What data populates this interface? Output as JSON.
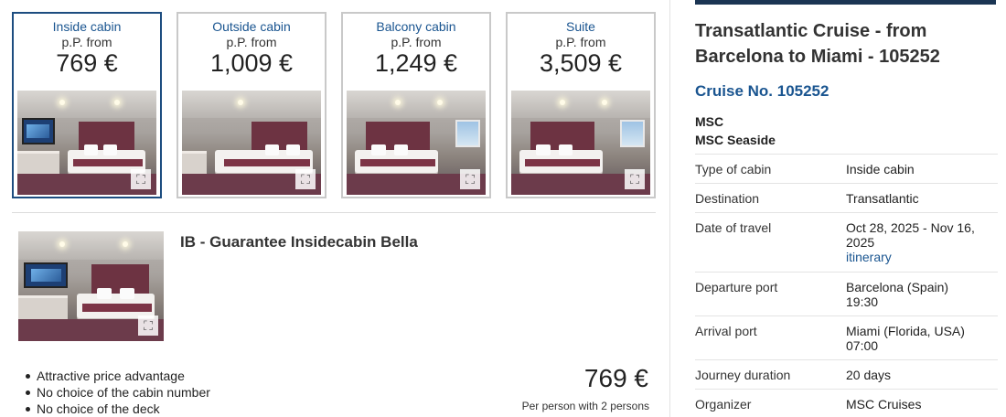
{
  "cabins": [
    {
      "name": "Inside cabin",
      "from_label": "p.P. from",
      "price": "769 €",
      "selected": true
    },
    {
      "name": "Outside cabin",
      "from_label": "p.P. from",
      "price": "1,009 €",
      "selected": false
    },
    {
      "name": "Balcony cabin",
      "from_label": "p.P. from",
      "price": "1,249 €",
      "selected": false
    },
    {
      "name": "Suite",
      "from_label": "p.P. from",
      "price": "3,509 €",
      "selected": false
    }
  ],
  "detail": {
    "title": "IB - Guarantee Insidecabin Bella",
    "features": [
      "Attractive price advantage",
      "No choice of the cabin number",
      "No choice of the deck"
    ],
    "price": "769 €",
    "price_note": "Per person with 2 persons"
  },
  "trip": {
    "title": "Transatlantic Cruise - from Barcelona to Miami - 105252",
    "cruise_no": "Cruise No. 105252",
    "line": "MSC",
    "ship": "MSC Seaside",
    "info": [
      {
        "key": "Type of cabin",
        "value": "Inside cabin"
      },
      {
        "key": "Destination",
        "value": "Transatlantic"
      },
      {
        "key": "Date of travel",
        "value": "Oct 28, 2025 - Nov 16, 2025",
        "link": "itinerary"
      },
      {
        "key": "Departure port",
        "value": "Barcelona (Spain)",
        "value2": "19:30"
      },
      {
        "key": "Arrival port",
        "value": "Miami (Florida, USA)",
        "value2": "07:00"
      },
      {
        "key": "Journey duration",
        "value": "20 days"
      },
      {
        "key": "Organizer",
        "value": "MSC Cruises"
      }
    ]
  },
  "icons": {
    "expand": "expand-icon",
    "bullet": "bullet-icon"
  },
  "colors": {
    "accent_blue": "#1a5590",
    "selected_border": "#1d4d80",
    "header_bar": "#1b3553"
  }
}
